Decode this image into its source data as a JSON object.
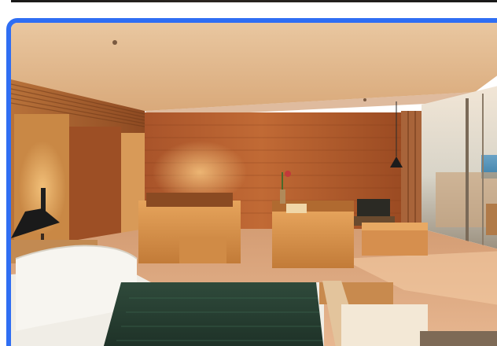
{
  "image": {
    "alt": "",
    "accent_border_color": "#2f6ef3"
  }
}
